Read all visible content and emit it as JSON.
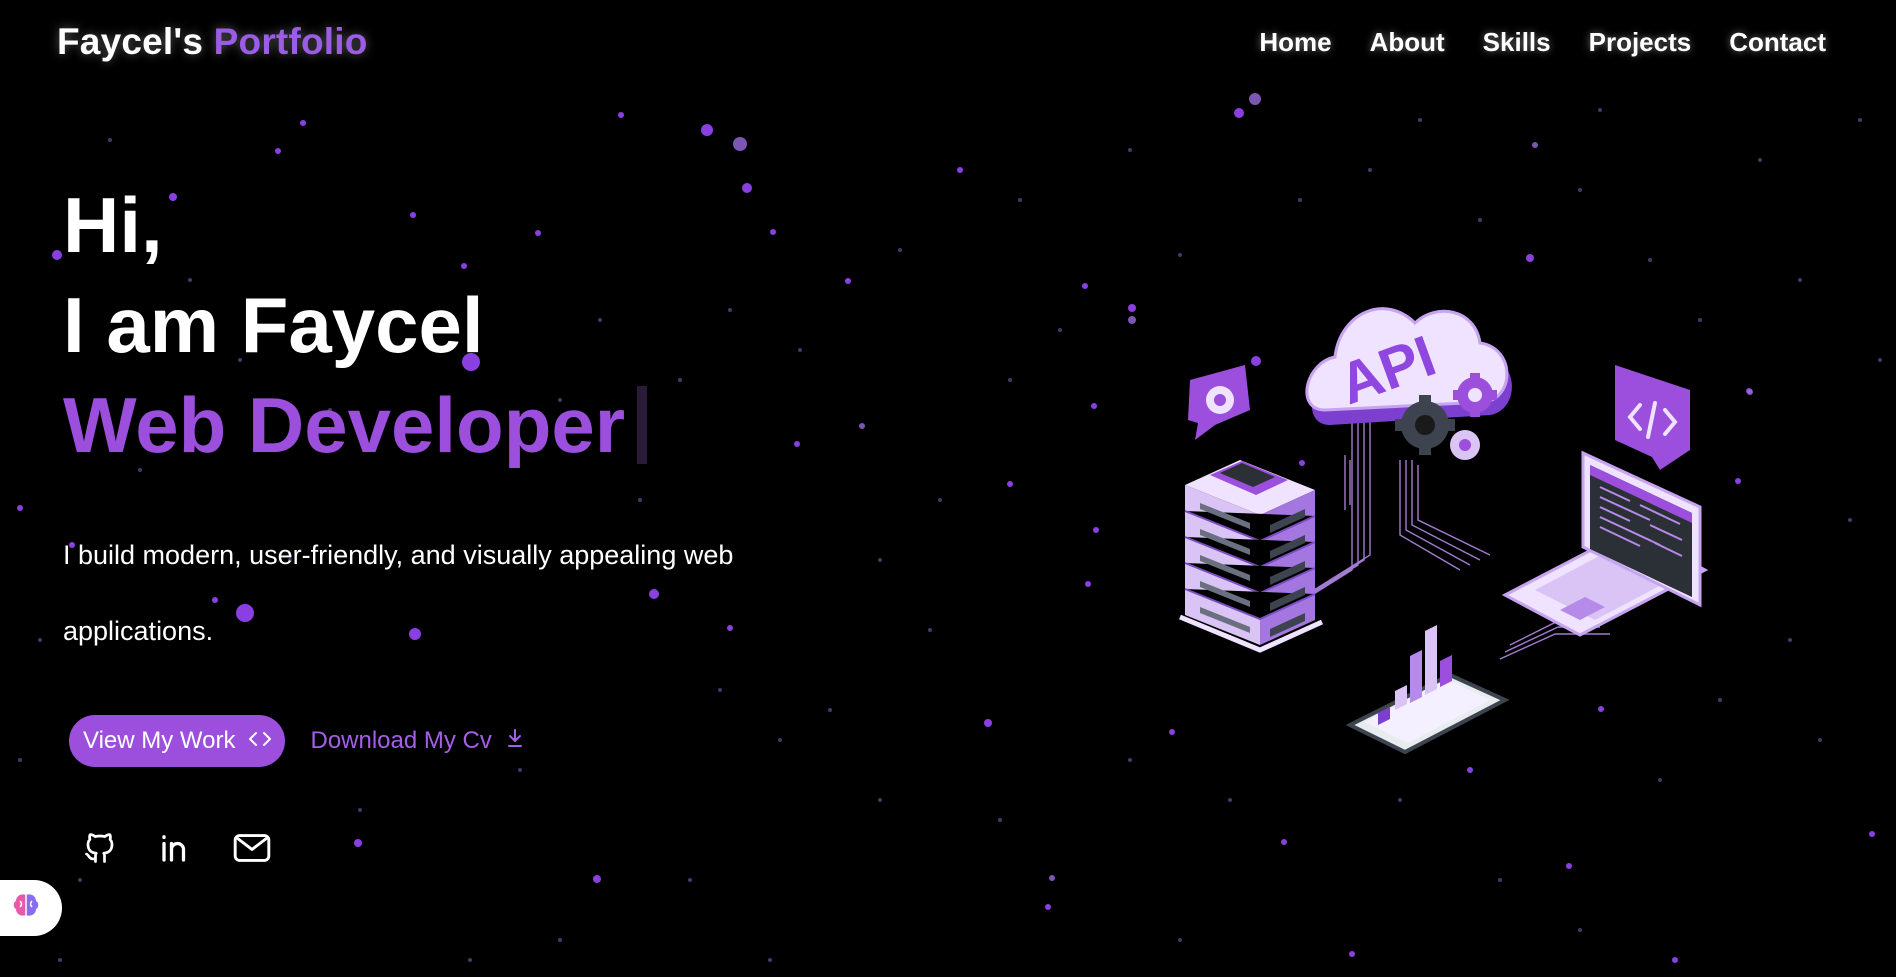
{
  "header": {
    "logo_main": "Faycel's",
    "logo_accent": "Portfolio",
    "nav": [
      {
        "label": "Home"
      },
      {
        "label": "About"
      },
      {
        "label": "Skills"
      },
      {
        "label": "Projects"
      },
      {
        "label": "Contact"
      }
    ]
  },
  "hero": {
    "greeting": "Hi,",
    "intro": "I am Faycel",
    "role": "Web Developer",
    "description": "I build modern, user-friendly, and visually appealing web applications.",
    "primary_button": "View My Work",
    "secondary_button": "Download My Cv"
  },
  "illustration": {
    "cloud_label": "API"
  },
  "socials": [
    {
      "icon": "github-icon"
    },
    {
      "icon": "linkedin-icon"
    },
    {
      "icon": "mail-icon"
    }
  ],
  "colors": {
    "background": "#000000",
    "accent": "#9b4fdc",
    "accent_light": "#d9c4f5",
    "text": "#ffffff"
  }
}
